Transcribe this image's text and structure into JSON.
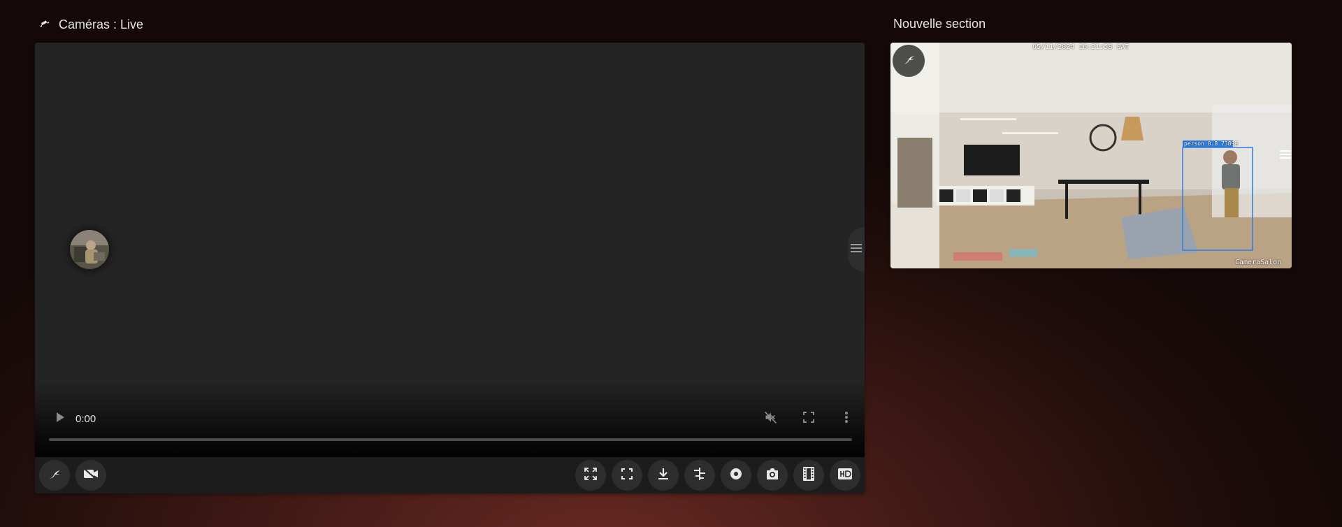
{
  "sections": {
    "left_title": "Caméras : Live",
    "left_icon": "cctv-icon",
    "right_title": "Nouvelle section"
  },
  "player": {
    "time": "0:00",
    "progress": 0,
    "muted": true
  },
  "toolbar": {
    "left_buttons": [
      {
        "icon": "frigate-icon"
      },
      {
        "icon": "video-camera-icon"
      }
    ],
    "right_buttons": [
      {
        "icon": "expand-icon"
      },
      {
        "icon": "fullscreen-icon"
      },
      {
        "icon": "download-icon"
      },
      {
        "icon": "timeline-icon"
      },
      {
        "icon": "record-icon"
      },
      {
        "icon": "camera-snapshot-icon"
      },
      {
        "icon": "film-strip-icon"
      },
      {
        "icon": "hd-icon"
      }
    ]
  },
  "preview": {
    "timestamp": "05/11/2024 16:21:58 SAT",
    "camera_name": "CameraSalon",
    "detection_label": "person 0.8 73898"
  },
  "colors": {
    "background": "#1f0d0b",
    "card": "#1c1c1c",
    "video": "#242424",
    "detection_box": "#2f7fe0"
  }
}
